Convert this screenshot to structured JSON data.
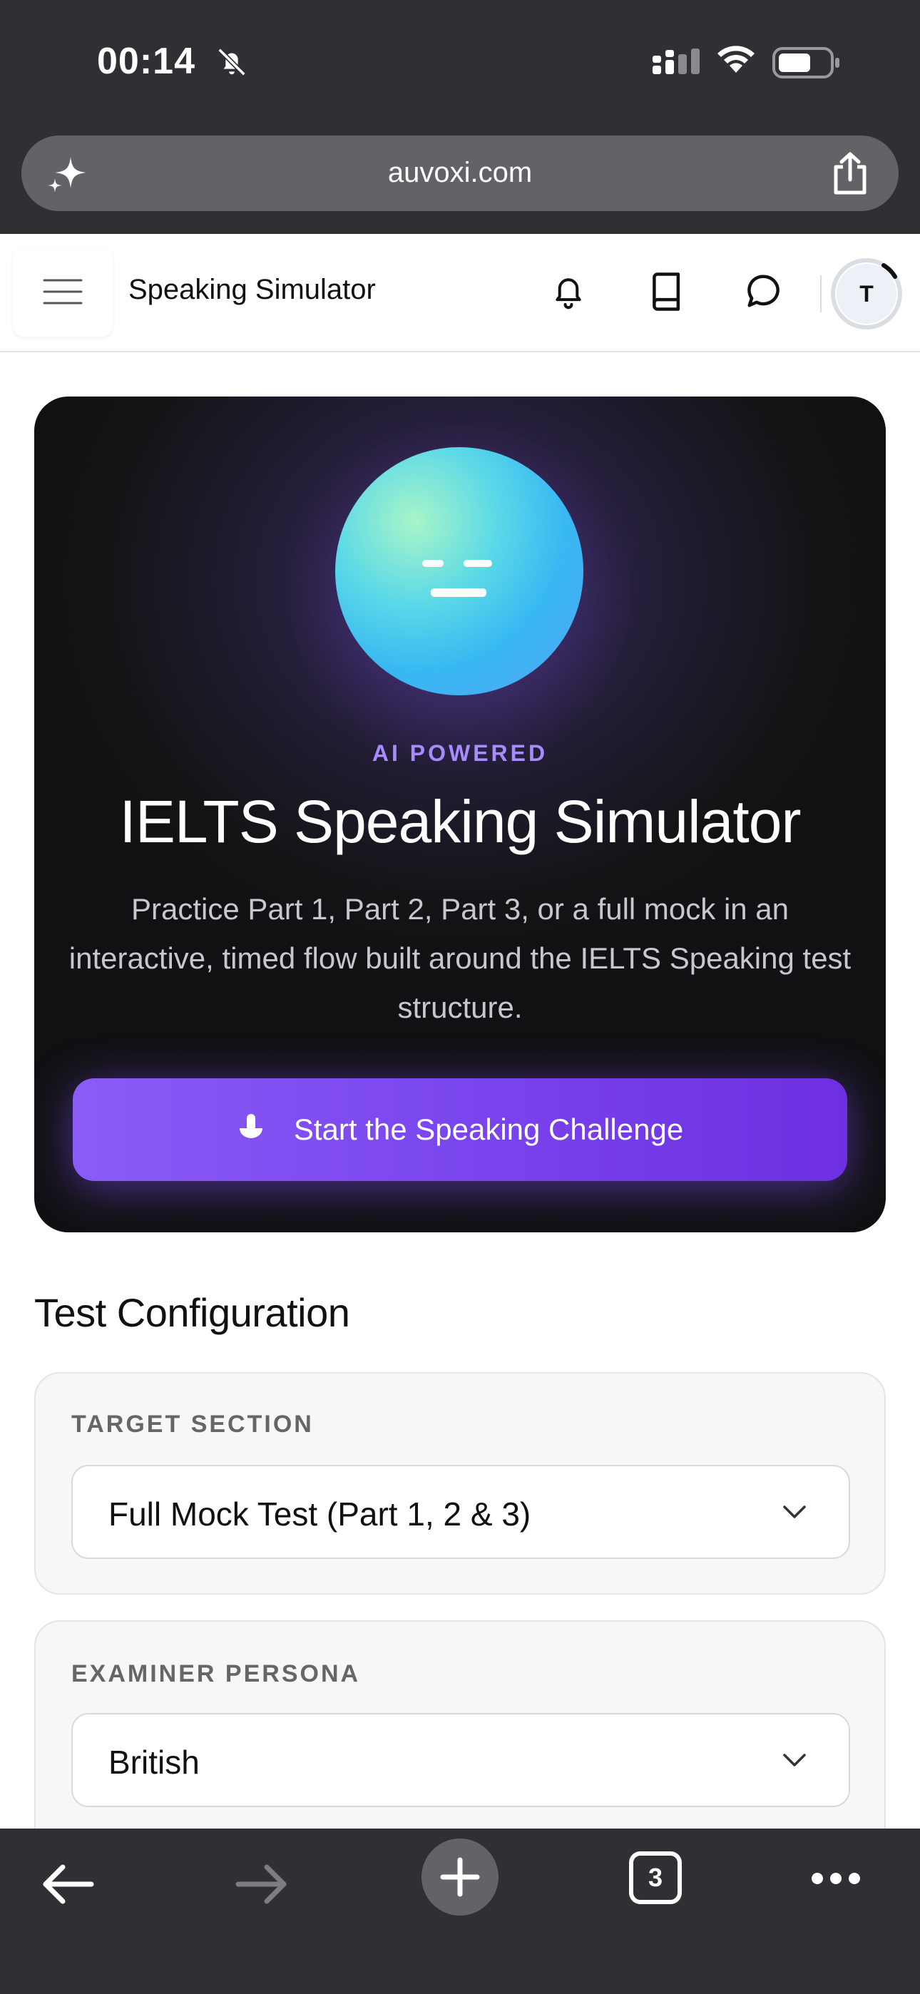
{
  "status_bar": {
    "time": "00:14"
  },
  "browser": {
    "url": "auvoxi.com",
    "tab_count": "3"
  },
  "header": {
    "title": "Speaking Simulator",
    "avatar_initial": "T"
  },
  "hero": {
    "badge": "AI POWERED",
    "title": "IELTS Speaking Simulator",
    "description": "Practice Part 1, Part 2, Part 3, or a full mock in an interactive, timed flow built around the IELTS Speaking test structure.",
    "cta_label": "Start the Speaking Challenge"
  },
  "config": {
    "title": "Test Configuration",
    "target_section": {
      "label": "TARGET SECTION",
      "value": "Full Mock Test (Part 1, 2 & 3)"
    },
    "examiner_persona": {
      "label": "EXAMINER PERSONA",
      "value": "British"
    }
  },
  "colors": {
    "accent": "#7a45ee",
    "badge": "#a98bff",
    "browser_chrome": "#2f3034"
  }
}
